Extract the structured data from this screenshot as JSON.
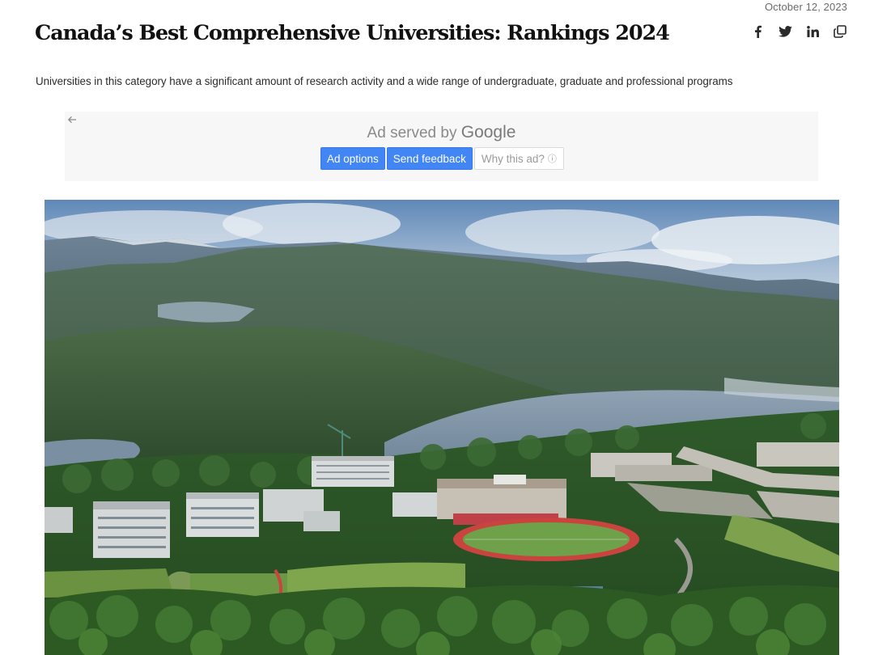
{
  "article": {
    "date": "October 12, 2023",
    "title": "Canada’s Best Comprehensive Universities: Rankings 2024",
    "subtitle": "Universities in this category have a significant amount of research activity and a wide range of undergraduate, graduate and professional programs"
  },
  "share": {
    "icons": [
      "facebook-icon",
      "twitter-icon",
      "linkedin-icon",
      "copy-link-icon"
    ]
  },
  "ad": {
    "served_by": "Ad served by",
    "brand": "Google",
    "options_label": "Ad options",
    "feedback_label": "Send feedback",
    "why_label": "Why this ad?",
    "info_glyph": "ⓘ"
  },
  "colors": {
    "ad_button_blue": "#4285f4",
    "text_primary": "#111111",
    "text_muted": "#6b6b6b"
  }
}
